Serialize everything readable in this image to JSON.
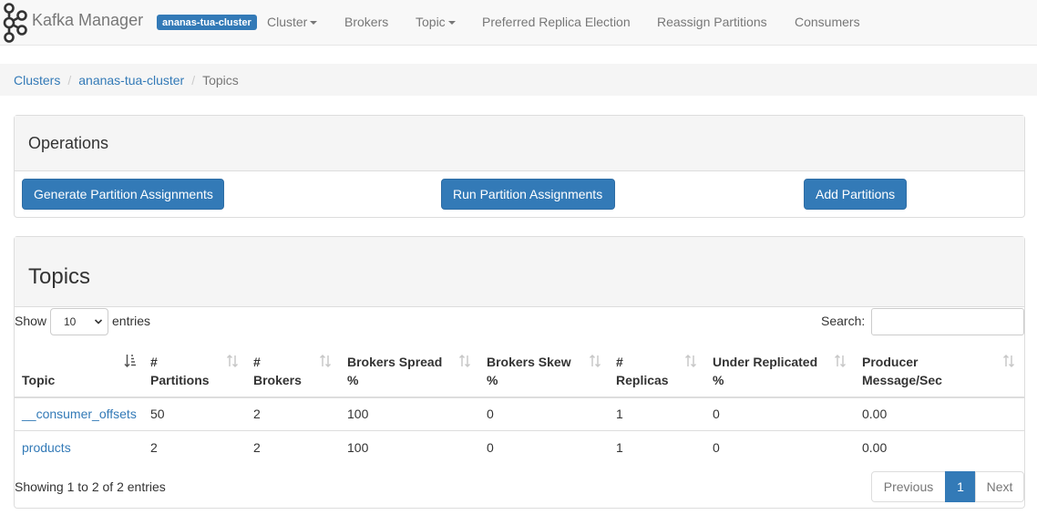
{
  "navbar": {
    "brand": "Kafka Manager",
    "cluster_label": "ananas-tua-cluster",
    "items": [
      "Cluster",
      "Brokers",
      "Topic",
      "Preferred Replica Election",
      "Reassign Partitions",
      "Consumers"
    ]
  },
  "breadcrumb": {
    "items": [
      "Clusters",
      "ananas-tua-cluster",
      "Topics"
    ]
  },
  "operations": {
    "title": "Operations",
    "buttons": [
      "Generate Partition Assignments",
      "Run Partition Assignments",
      "Add Partitions"
    ]
  },
  "topics": {
    "title": "Topics",
    "show_label": "Show",
    "page_length": "10",
    "entries_label": "entries",
    "search_label": "Search:",
    "columns": [
      {
        "line1": "Topic",
        "line2": ""
      },
      {
        "line1": "#",
        "line2": "Partitions"
      },
      {
        "line1": "#",
        "line2": "Brokers"
      },
      {
        "line1": "Brokers Spread",
        "line2": "%"
      },
      {
        "line1": "Brokers Skew",
        "line2": "%"
      },
      {
        "line1": "#",
        "line2": "Replicas"
      },
      {
        "line1": "Under Replicated",
        "line2": "%"
      },
      {
        "line1": "Producer",
        "line2": "Message/Sec"
      }
    ],
    "rows": [
      [
        "__consumer_offsets",
        "50",
        "2",
        "100",
        "0",
        "1",
        "0",
        "0.00"
      ],
      [
        "products",
        "2",
        "2",
        "100",
        "0",
        "1",
        "0",
        "0.00"
      ]
    ],
    "info": "Showing 1 to 2 of 2 entries",
    "pagination": {
      "previous": "Previous",
      "current": "1",
      "next": "Next"
    }
  },
  "colors": {
    "primary": "#337ab7",
    "nav_text": "#777777"
  }
}
